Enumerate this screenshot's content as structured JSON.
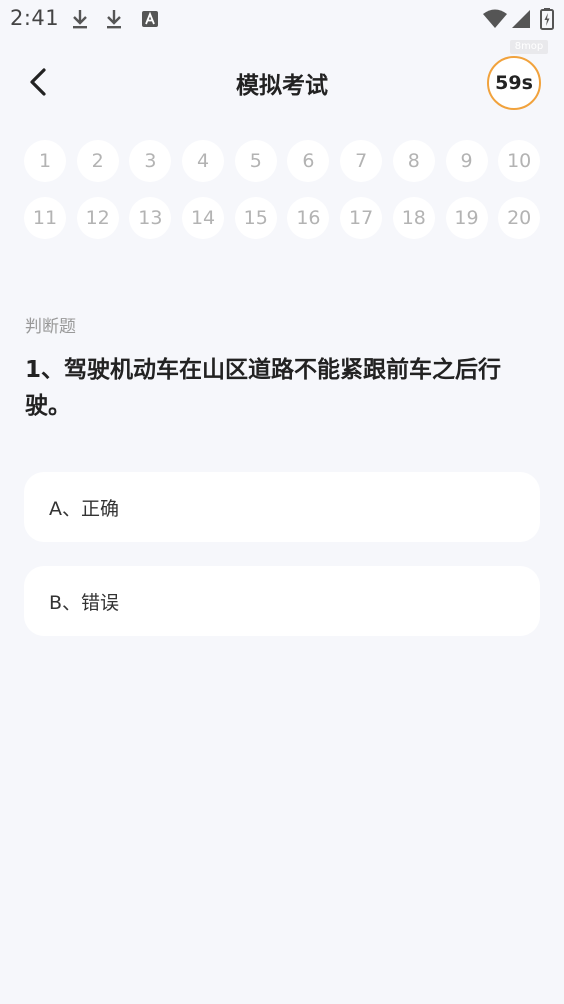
{
  "status_bar": {
    "time": "2:41",
    "icons": [
      "download-icon",
      "download-icon",
      "a-icon",
      "wifi-icon",
      "signal-icon",
      "battery-icon"
    ]
  },
  "watermark": "8mop",
  "header": {
    "title": "模拟考试",
    "timer": "59s",
    "back_icon": "chevron-left-icon",
    "timer_ring_color": "#f1a23c"
  },
  "question_numbers": [
    "1",
    "2",
    "3",
    "4",
    "5",
    "6",
    "7",
    "8",
    "9",
    "10",
    "11",
    "12",
    "13",
    "14",
    "15",
    "16",
    "17",
    "18",
    "19",
    "20"
  ],
  "question": {
    "type": "判断题",
    "text": "1、驾驶机动车在山区道路不能紧跟前车之后行驶。"
  },
  "options": [
    {
      "label": "A、正确"
    },
    {
      "label": "B、错误"
    }
  ],
  "colors": {
    "background": "#f6f7fb",
    "card": "#ffffff",
    "accent": "#f1a23c"
  }
}
